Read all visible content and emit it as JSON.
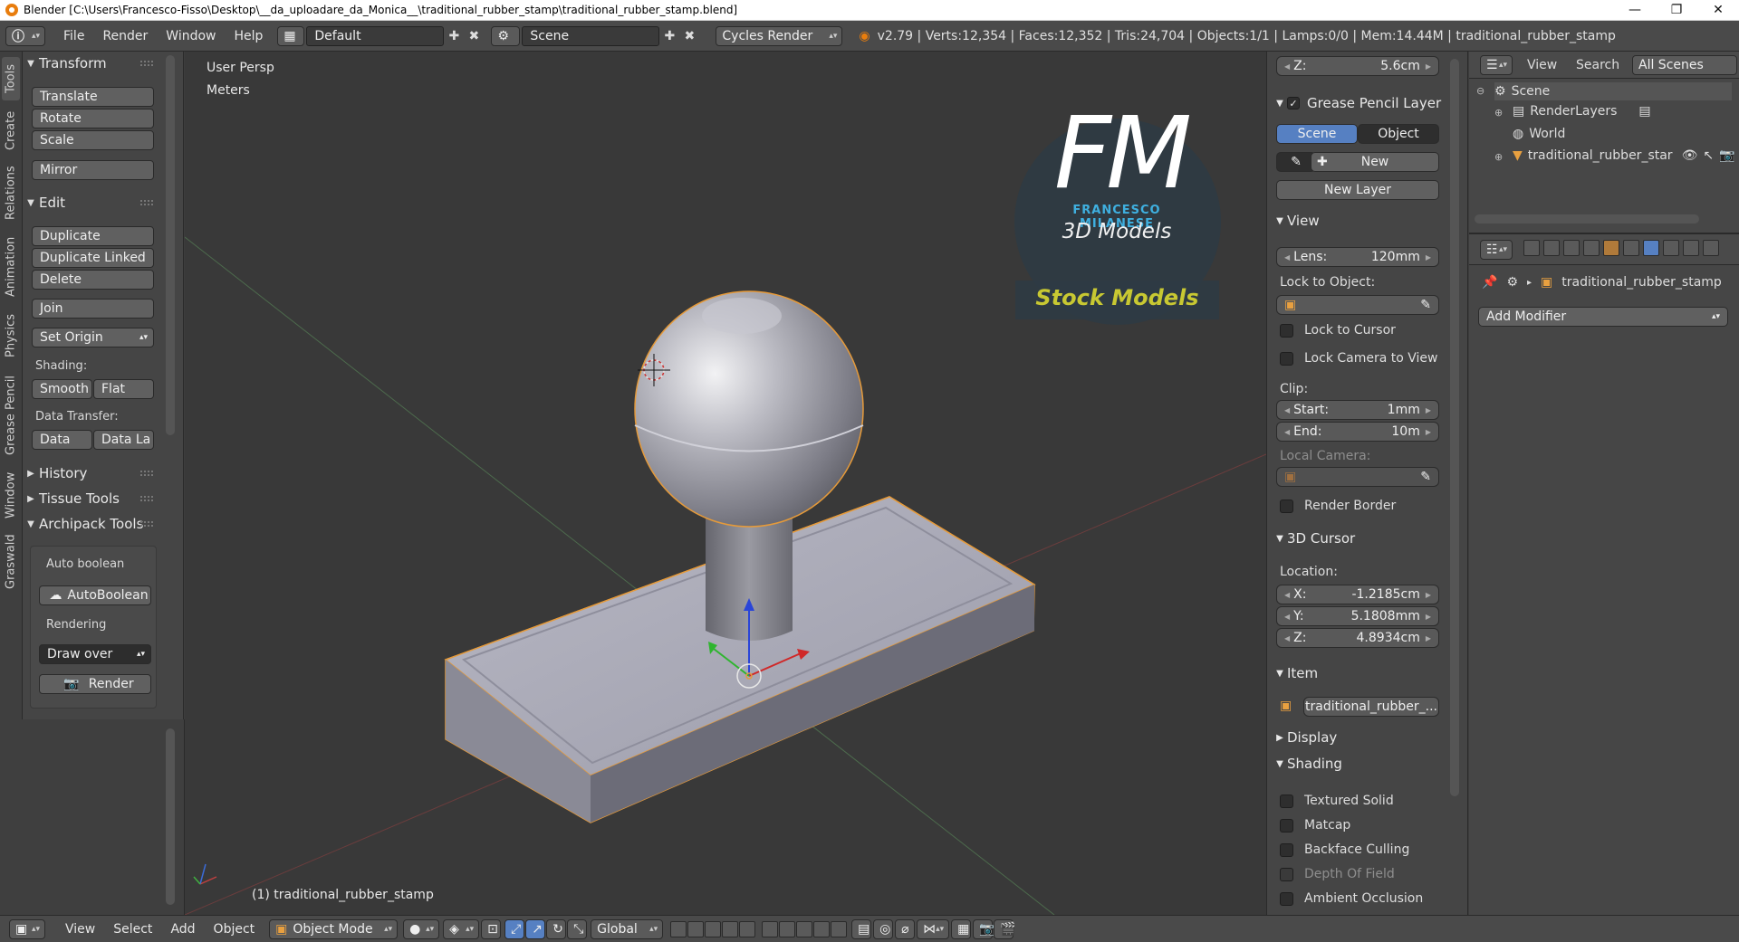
{
  "window": {
    "title": "Blender [C:\\Users\\Francesco-Fisso\\Desktop\\__da_uploadare_da_Monica__\\traditional_rubber_stamp\\traditional_rubber_stamp.blend]",
    "minimize": "—",
    "maximize": "❐",
    "close": "✕"
  },
  "infobar": {
    "menus": [
      "File",
      "Render",
      "Window",
      "Help"
    ],
    "layout": "Default",
    "scene": "Scene",
    "engine": "Cycles Render",
    "stats": "v2.79 | Verts:12,354 | Faces:12,352 | Tris:24,704 | Objects:1/1 | Lamps:0/0 | Mem:14.44M | traditional_rubber_stamp"
  },
  "sidetabs": [
    "Tools",
    "Create",
    "Relations",
    "Animation",
    "Physics",
    "Grease Pencil",
    "Window",
    "Graswald"
  ],
  "toolshelf": {
    "transform": {
      "title": "Transform",
      "buttons": [
        "Translate",
        "Rotate",
        "Scale",
        "Mirror"
      ]
    },
    "edit": {
      "title": "Edit",
      "buttons": [
        "Duplicate",
        "Duplicate Linked",
        "Delete",
        "Join"
      ],
      "set_origin": "Set Origin",
      "shading_label": "Shading:",
      "smooth": "Smooth",
      "flat": "Flat",
      "data_transfer_label": "Data Transfer:",
      "data": "Data",
      "data_la": "Data La"
    },
    "history": "History",
    "tissue": "Tissue Tools",
    "archipack": {
      "title": "Archipack Tools",
      "auto_boolean_label": "Auto boolean",
      "autoboolean_btn": "AutoBoolean",
      "rendering_label": "Rendering",
      "draw_over": "Draw over",
      "render_btn": "Render"
    }
  },
  "viewport": {
    "view_name": "User Persp",
    "units": "Meters",
    "object_label": "(1) traditional_rubber_stamp",
    "logo": {
      "letters": "FM",
      "name": "FRANCESCO MILANESE",
      "sub": "3D Models",
      "stock": "Stock Models"
    }
  },
  "npanel": {
    "z_top": {
      "label": "Z:",
      "value": "5.6cm"
    },
    "grease": {
      "title": "Grease Pencil Layer",
      "scene_tab": "Scene",
      "object_tab": "Object",
      "new": "New",
      "new_layer": "New Layer"
    },
    "view": {
      "title": "View",
      "lens_label": "Lens:",
      "lens_value": "120mm",
      "lock_object_label": "Lock to Object:",
      "lock_cursor": "Lock to Cursor",
      "lock_camera": "Lock Camera to View",
      "clip_label": "Clip:",
      "clip_start_label": "Start:",
      "clip_start": "1mm",
      "clip_end_label": "End:",
      "clip_end": "10m",
      "local_camera": "Local Camera:",
      "render_border": "Render Border"
    },
    "cursor": {
      "title": "3D Cursor",
      "location_label": "Location:",
      "x_label": "X:",
      "x": "-1.2185cm",
      "y_label": "Y:",
      "y": "5.1808mm",
      "z_label": "Z:",
      "z": "4.8934cm"
    },
    "item": {
      "title": "Item",
      "name": "traditional_rubber_..."
    },
    "display": "Display",
    "shading": {
      "title": "Shading",
      "options": [
        "Textured Solid",
        "Matcap",
        "Backface Culling",
        "Depth Of Field",
        "Ambient Occlusion"
      ]
    }
  },
  "outliner": {
    "view": "View",
    "search": "Search",
    "all_scenes": "All Scenes",
    "scene": "Scene",
    "render_layers": "RenderLayers",
    "world": "World",
    "object": "traditional_rubber_star"
  },
  "properties": {
    "object_name": "traditional_rubber_stamp",
    "add_modifier": "Add Modifier"
  },
  "bottombar": {
    "menus": [
      "View",
      "Select",
      "Add",
      "Object"
    ],
    "mode": "Object Mode",
    "orientation": "Global"
  }
}
